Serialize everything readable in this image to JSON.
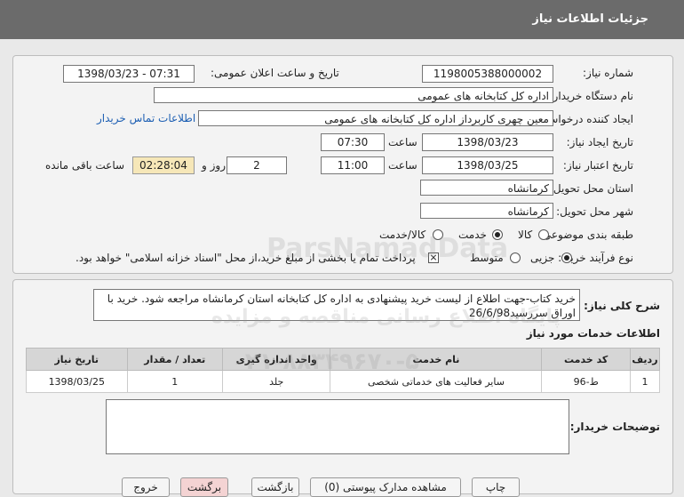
{
  "header": {
    "title": "جزئیات اطلاعات نیاز"
  },
  "form": {
    "need_number_label": "شماره نیاز:",
    "need_number": "1198005388000002",
    "announce_label": "تاریخ و ساعت اعلان عمومی:",
    "announce_value": "1398/03/23 - 07:31",
    "buyer_org_label": "نام دستگاه خریدار:",
    "buyer_org": "اداره کل کتابخانه های عمومی",
    "creator_label": "ایجاد کننده درخواست:",
    "creator": "معین چهری کاربرداز اداره کل کتابخانه های عمومی",
    "contact_link": "اطلاعات تماس خریدار",
    "created_date_label": "تاریخ ایجاد نیاز:",
    "created_date": "1398/03/23",
    "time_label": "ساعت",
    "created_time": "07:30",
    "validity_label": "تاریخ اعتبار نیاز:",
    "validity_date": "1398/03/25",
    "validity_time": "11:00",
    "days": "2",
    "days_label": "روز و",
    "remaining": "02:28:04",
    "remaining_label": "ساعت باقی مانده",
    "province_label": "استان محل تحویل:",
    "province": "کرمانشاه",
    "city_label": "شهر محل تحویل:",
    "city": "کرمانشاه",
    "category_label": "طبقه بندی موضوعی:",
    "category_options": [
      "کالا",
      "خدمت",
      "کالا/خدمت"
    ],
    "category_selected": 1,
    "process_label": "نوع فرآیند خرید :",
    "process_options": [
      "جزیی",
      "متوسط"
    ],
    "process_selected": 0,
    "payment_note": "پرداخت تمام یا بخشی از مبلغ خرید،از محل \"اسناد خزانه اسلامی\" خواهد بود."
  },
  "summary": {
    "label": "شرح کلی نیاز:",
    "text": "خرید کتاب-جهت اطلاع از لیست خرید پیشنهادی به اداره کل کتابخانه استان کرمانشاه مراجعه شود. خرید با اوراق سررسید26/6/98"
  },
  "services": {
    "title": "اطلاعات خدمات مورد نیاز",
    "columns": [
      "ردیف",
      "کد خدمت",
      "نام خدمت",
      "واحد اندازه گیری",
      "تعداد / مقدار",
      "تاریخ نیاز"
    ],
    "rows": [
      [
        "1",
        "ط-96",
        "سایر فعالیت های خدماتی شخصی",
        "جلد",
        "1",
        "1398/03/25"
      ]
    ]
  },
  "buyer_notes": {
    "label": "توضیحات خریدار:"
  },
  "watermark": {
    "brand": "ParsNamadData",
    "text": "پایگاه اطلاع رسانی مناقصه و مزایده",
    "phone": "۰۲۱-۸۸۳۴۹۶۷۰-۵"
  },
  "bottom_buttons": [
    "چاپ",
    "بازگشت",
    "مشاهده مدارک پیوستی (0)",
    "برگشت",
    "خروج"
  ]
}
